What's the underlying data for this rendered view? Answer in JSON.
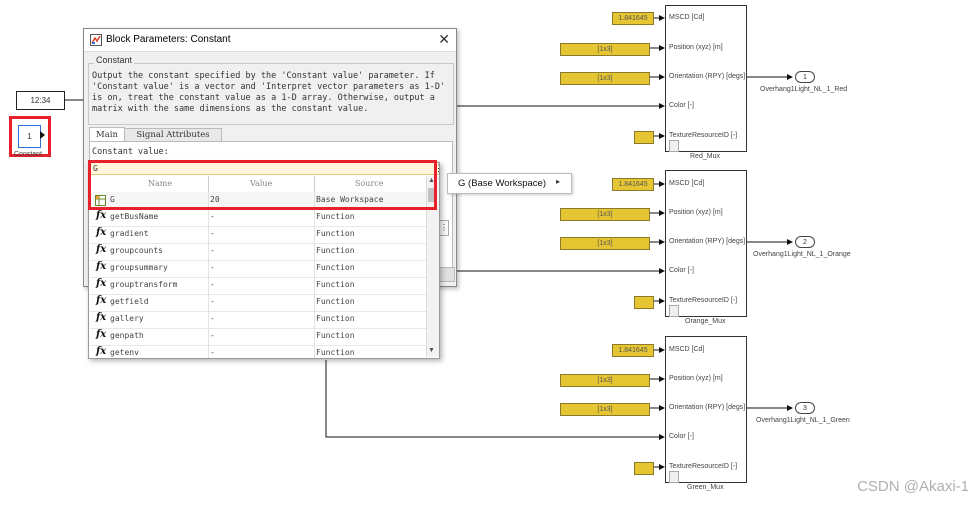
{
  "dialog": {
    "title": "Block Parameters: Constant",
    "group_label": "Constant",
    "description": "Output the constant specified by the 'Constant value' parameter. If 'Constant value' is a vector and 'Interpret vector parameters as 1-D' is on, treat the constant value as a 1-D array. Otherwise, output a matrix with the same dimensions as the constant value.",
    "tabs": [
      "Main",
      "Signal Attributes"
    ],
    "field_label": "Constant value:"
  },
  "popup": {
    "input": "G",
    "headers": [
      "Name",
      "Value",
      "Source"
    ],
    "rows": [
      {
        "icon": "table",
        "name": "G",
        "value": "20",
        "source": "Base Workspace"
      },
      {
        "icon": "fx",
        "name": "getBusName",
        "value": "-",
        "source": "Function"
      },
      {
        "icon": "fx",
        "name": "gradient",
        "value": "-",
        "source": "Function"
      },
      {
        "icon": "fx",
        "name": "groupcounts",
        "value": "-",
        "source": "Function"
      },
      {
        "icon": "fx",
        "name": "groupsummary",
        "value": "-",
        "source": "Function"
      },
      {
        "icon": "fx",
        "name": "grouptransform",
        "value": "-",
        "source": "Function"
      },
      {
        "icon": "fx",
        "name": "getfield",
        "value": "-",
        "source": "Function"
      },
      {
        "icon": "fx",
        "name": "gallery",
        "value": "-",
        "source": "Function"
      },
      {
        "icon": "fx",
        "name": "genpath",
        "value": "-",
        "source": "Function"
      },
      {
        "icon": "fx",
        "name": "getenv",
        "value": "-",
        "source": "Function"
      }
    ],
    "submenu": "G (Base Workspace)"
  },
  "canvas": {
    "clock_value": "12:34",
    "constant_value": "1",
    "constant_label": "Constant",
    "mscd_value": "1.841645",
    "vec_value": "[1x3]",
    "port_labels": [
      "MSCD [Cd]",
      "Position (xyz) [m]",
      "Orientation (RPY) [degs]",
      "Color [-]",
      "TextureResourceID [-]"
    ],
    "muxes": [
      {
        "name": "Red_Mux",
        "out_num": "1",
        "out_label": "Overhang1Light_NL_1_Red"
      },
      {
        "name": "Orange_Mux",
        "out_num": "2",
        "out_label": "Overhang1Light_NL_1_Orange"
      },
      {
        "name": "Green_Mux",
        "out_num": "3",
        "out_label": "Overhang1Light_NL_1_Green"
      }
    ]
  },
  "watermark": "CSDN @Akaxi-1"
}
